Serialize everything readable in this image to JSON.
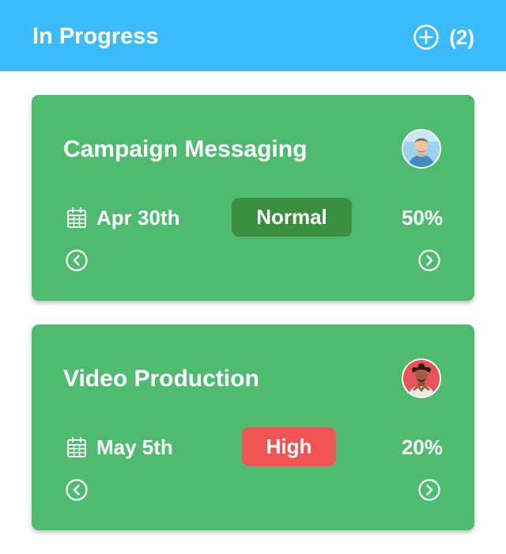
{
  "header": {
    "title": "In Progress",
    "count": "(2)",
    "add_icon": "add-circle-icon",
    "background": "#3dbcfd"
  },
  "cards": [
    {
      "title": "Campaign Messaging",
      "date": "Apr 30th",
      "priority": "Normal",
      "priority_color": "#3b8f3e",
      "progress": "50%",
      "avatar_icon": "user-avatar-1",
      "background": "#4ebb70"
    },
    {
      "title": "Video Production",
      "date": "May 5th",
      "priority": "High",
      "priority_color": "#f05455",
      "progress": "20%",
      "avatar_icon": "user-avatar-2",
      "background": "#4ebb70"
    }
  ]
}
